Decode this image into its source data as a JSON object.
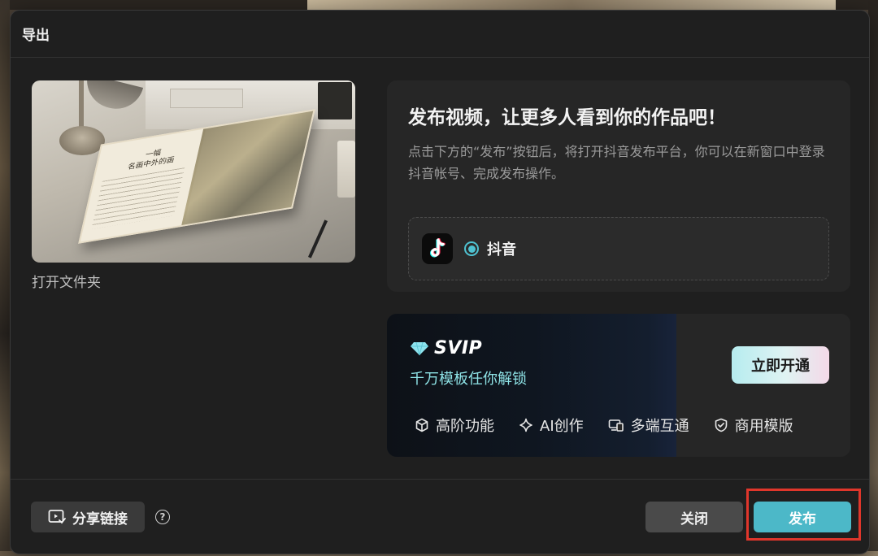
{
  "modal": {
    "title": "导出"
  },
  "preview": {
    "book_text": "一幅\n名画中外的画",
    "open_folder_label": "打开文件夹"
  },
  "publish": {
    "title": "发布视频，让更多人看到你的作品吧！",
    "description": "点击下方的“发布”按钮后，将打开抖音发布平台，你可以在新窗口中登录抖音帐号、完成发布操作。",
    "platform": {
      "name": "抖音",
      "icon": "tiktok-icon",
      "selected": true
    }
  },
  "svip": {
    "name": "SVIP",
    "subtitle": "千万模板任你解锁",
    "cta_label": "立即开通",
    "features": [
      {
        "icon": "cube-icon",
        "label": "高阶功能"
      },
      {
        "icon": "sparkle-icon",
        "label": "AI创作"
      },
      {
        "icon": "devices-icon",
        "label": "多端互通"
      },
      {
        "icon": "shield-check-icon",
        "label": "商用模版"
      }
    ]
  },
  "footer": {
    "share_label": "分享链接",
    "help_icon": "question-circle-icon",
    "close_label": "关闭",
    "publish_label": "发布"
  },
  "colors": {
    "accent": "#4cb8c8",
    "highlight": "#e0362b",
    "svip_text": "#8ee3e6"
  }
}
